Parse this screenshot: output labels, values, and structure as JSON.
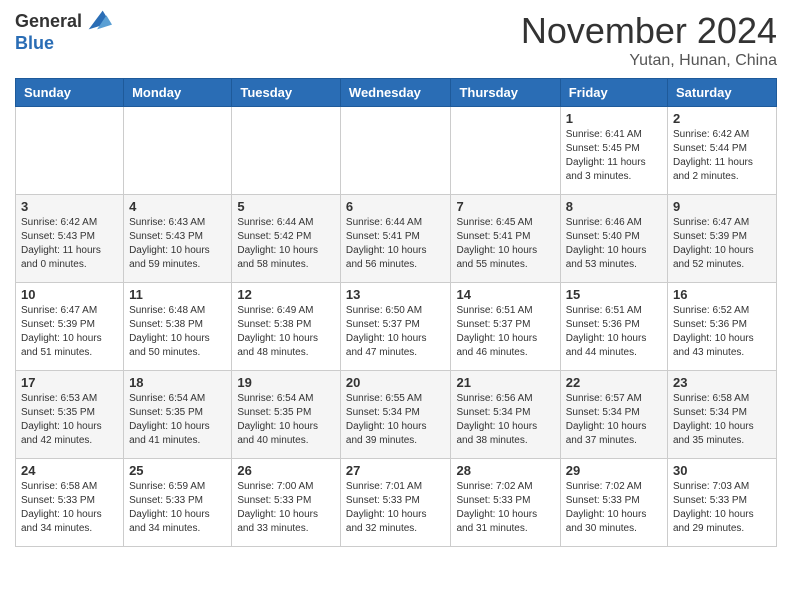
{
  "header": {
    "logo_general": "General",
    "logo_blue": "Blue",
    "month_title": "November 2024",
    "location": "Yutan, Hunan, China"
  },
  "days_of_week": [
    "Sunday",
    "Monday",
    "Tuesday",
    "Wednesday",
    "Thursday",
    "Friday",
    "Saturday"
  ],
  "weeks": [
    [
      {
        "day": "",
        "info": ""
      },
      {
        "day": "",
        "info": ""
      },
      {
        "day": "",
        "info": ""
      },
      {
        "day": "",
        "info": ""
      },
      {
        "day": "",
        "info": ""
      },
      {
        "day": "1",
        "info": "Sunrise: 6:41 AM\nSunset: 5:45 PM\nDaylight: 11 hours\nand 3 minutes."
      },
      {
        "day": "2",
        "info": "Sunrise: 6:42 AM\nSunset: 5:44 PM\nDaylight: 11 hours\nand 2 minutes."
      }
    ],
    [
      {
        "day": "3",
        "info": "Sunrise: 6:42 AM\nSunset: 5:43 PM\nDaylight: 11 hours\nand 0 minutes."
      },
      {
        "day": "4",
        "info": "Sunrise: 6:43 AM\nSunset: 5:43 PM\nDaylight: 10 hours\nand 59 minutes."
      },
      {
        "day": "5",
        "info": "Sunrise: 6:44 AM\nSunset: 5:42 PM\nDaylight: 10 hours\nand 58 minutes."
      },
      {
        "day": "6",
        "info": "Sunrise: 6:44 AM\nSunset: 5:41 PM\nDaylight: 10 hours\nand 56 minutes."
      },
      {
        "day": "7",
        "info": "Sunrise: 6:45 AM\nSunset: 5:41 PM\nDaylight: 10 hours\nand 55 minutes."
      },
      {
        "day": "8",
        "info": "Sunrise: 6:46 AM\nSunset: 5:40 PM\nDaylight: 10 hours\nand 53 minutes."
      },
      {
        "day": "9",
        "info": "Sunrise: 6:47 AM\nSunset: 5:39 PM\nDaylight: 10 hours\nand 52 minutes."
      }
    ],
    [
      {
        "day": "10",
        "info": "Sunrise: 6:47 AM\nSunset: 5:39 PM\nDaylight: 10 hours\nand 51 minutes."
      },
      {
        "day": "11",
        "info": "Sunrise: 6:48 AM\nSunset: 5:38 PM\nDaylight: 10 hours\nand 50 minutes."
      },
      {
        "day": "12",
        "info": "Sunrise: 6:49 AM\nSunset: 5:38 PM\nDaylight: 10 hours\nand 48 minutes."
      },
      {
        "day": "13",
        "info": "Sunrise: 6:50 AM\nSunset: 5:37 PM\nDaylight: 10 hours\nand 47 minutes."
      },
      {
        "day": "14",
        "info": "Sunrise: 6:51 AM\nSunset: 5:37 PM\nDaylight: 10 hours\nand 46 minutes."
      },
      {
        "day": "15",
        "info": "Sunrise: 6:51 AM\nSunset: 5:36 PM\nDaylight: 10 hours\nand 44 minutes."
      },
      {
        "day": "16",
        "info": "Sunrise: 6:52 AM\nSunset: 5:36 PM\nDaylight: 10 hours\nand 43 minutes."
      }
    ],
    [
      {
        "day": "17",
        "info": "Sunrise: 6:53 AM\nSunset: 5:35 PM\nDaylight: 10 hours\nand 42 minutes."
      },
      {
        "day": "18",
        "info": "Sunrise: 6:54 AM\nSunset: 5:35 PM\nDaylight: 10 hours\nand 41 minutes."
      },
      {
        "day": "19",
        "info": "Sunrise: 6:54 AM\nSunset: 5:35 PM\nDaylight: 10 hours\nand 40 minutes."
      },
      {
        "day": "20",
        "info": "Sunrise: 6:55 AM\nSunset: 5:34 PM\nDaylight: 10 hours\nand 39 minutes."
      },
      {
        "day": "21",
        "info": "Sunrise: 6:56 AM\nSunset: 5:34 PM\nDaylight: 10 hours\nand 38 minutes."
      },
      {
        "day": "22",
        "info": "Sunrise: 6:57 AM\nSunset: 5:34 PM\nDaylight: 10 hours\nand 37 minutes."
      },
      {
        "day": "23",
        "info": "Sunrise: 6:58 AM\nSunset: 5:34 PM\nDaylight: 10 hours\nand 35 minutes."
      }
    ],
    [
      {
        "day": "24",
        "info": "Sunrise: 6:58 AM\nSunset: 5:33 PM\nDaylight: 10 hours\nand 34 minutes."
      },
      {
        "day": "25",
        "info": "Sunrise: 6:59 AM\nSunset: 5:33 PM\nDaylight: 10 hours\nand 34 minutes."
      },
      {
        "day": "26",
        "info": "Sunrise: 7:00 AM\nSunset: 5:33 PM\nDaylight: 10 hours\nand 33 minutes."
      },
      {
        "day": "27",
        "info": "Sunrise: 7:01 AM\nSunset: 5:33 PM\nDaylight: 10 hours\nand 32 minutes."
      },
      {
        "day": "28",
        "info": "Sunrise: 7:02 AM\nSunset: 5:33 PM\nDaylight: 10 hours\nand 31 minutes."
      },
      {
        "day": "29",
        "info": "Sunrise: 7:02 AM\nSunset: 5:33 PM\nDaylight: 10 hours\nand 30 minutes."
      },
      {
        "day": "30",
        "info": "Sunrise: 7:03 AM\nSunset: 5:33 PM\nDaylight: 10 hours\nand 29 minutes."
      }
    ]
  ]
}
